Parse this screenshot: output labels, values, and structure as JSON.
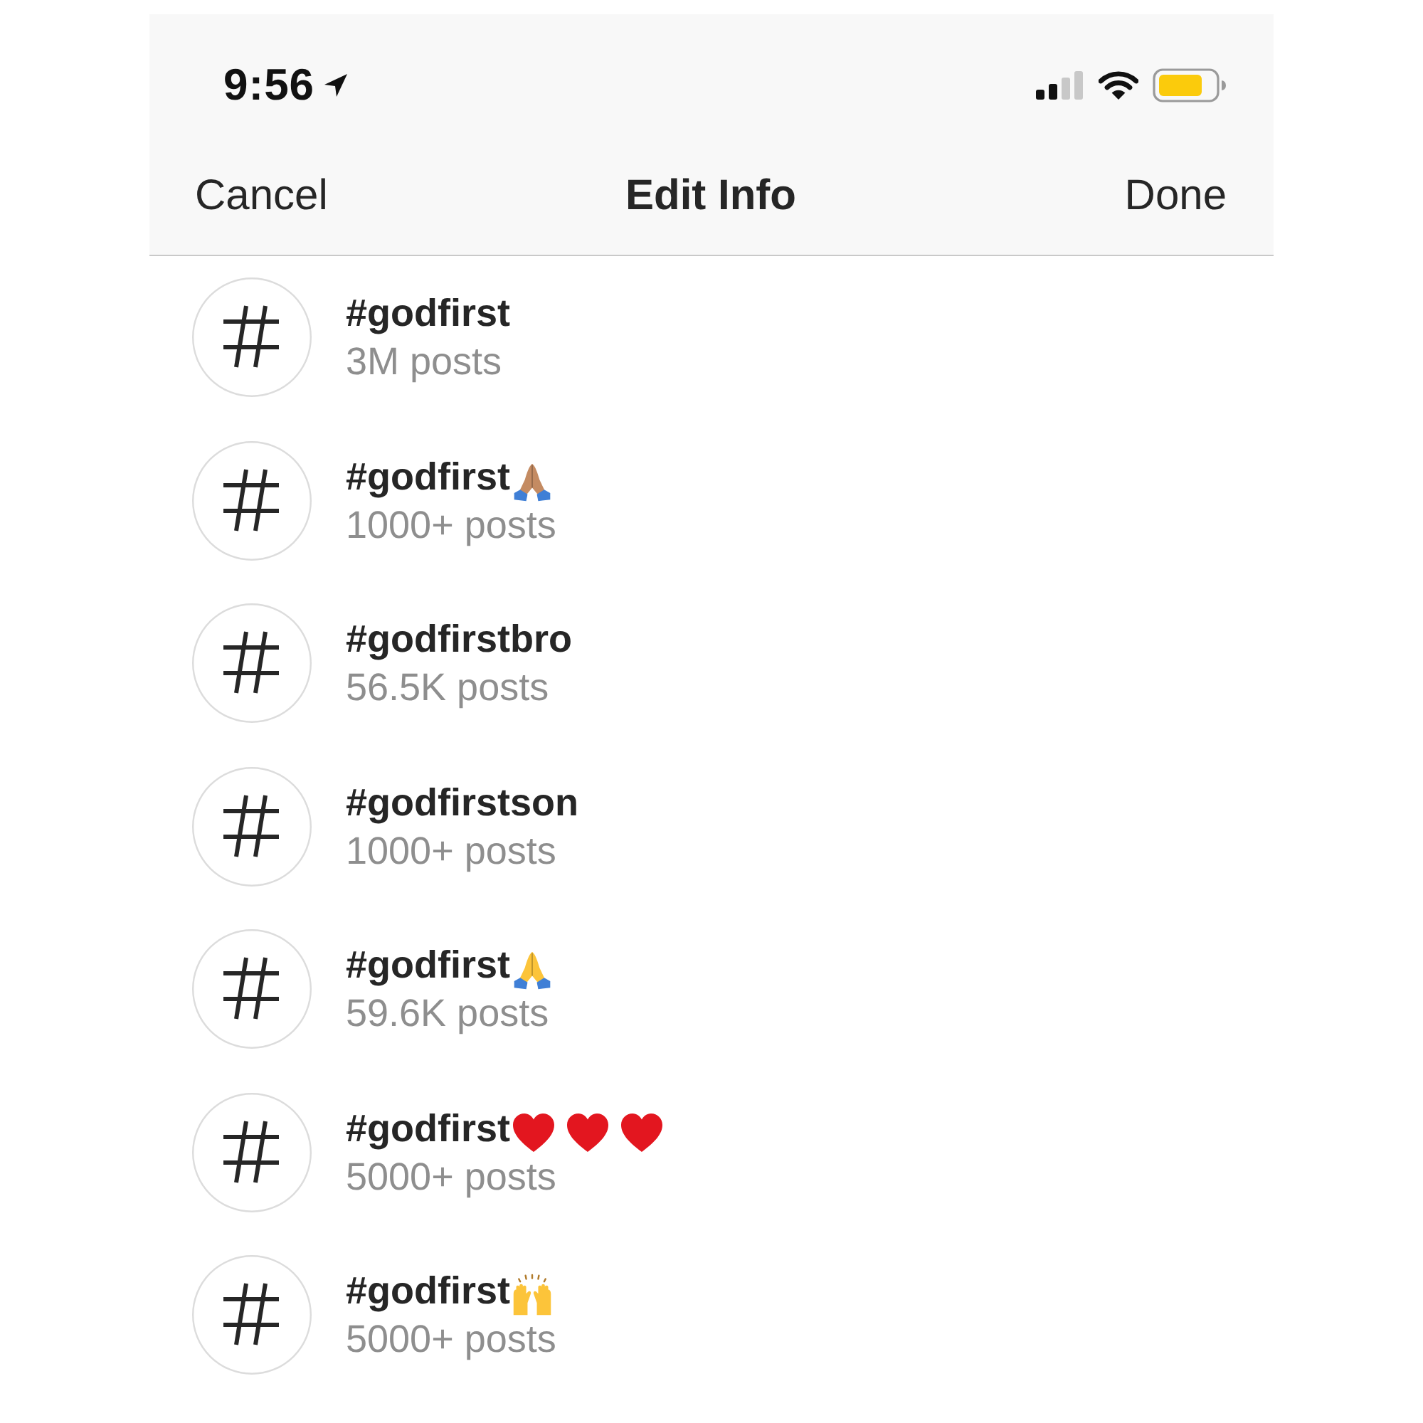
{
  "status_bar": {
    "time": "9:56"
  },
  "nav_bar": {
    "left_button": "Cancel",
    "title": "Edit Info",
    "right_button": "Done"
  },
  "hashtags": [
    {
      "tag": "#godfirst",
      "count": "3M posts"
    },
    {
      "tag": "#godfirst",
      "emojis": [
        {
          "kind": "praying-hands",
          "color": "#c48b62"
        }
      ],
      "count": "1000+ posts"
    },
    {
      "tag": "#godfirstbro",
      "count": "56.5K posts"
    },
    {
      "tag": "#godfirstson",
      "count": "1000+ posts"
    },
    {
      "tag": "#godfirst",
      "emojis": [
        {
          "kind": "praying-hands",
          "color": "#fcc43a"
        }
      ],
      "count": "59.6K posts"
    },
    {
      "tag": "#godfirst",
      "emojis": [
        {
          "kind": "heart",
          "color": "#e3161f"
        },
        {
          "kind": "heart",
          "color": "#e3161f"
        },
        {
          "kind": "heart",
          "color": "#e3161f"
        }
      ],
      "count": "5000+ posts"
    },
    {
      "tag": "#godfirst",
      "emojis": [
        {
          "kind": "raised-hands",
          "color": "#fcc43a"
        }
      ],
      "count": "5000+ posts"
    }
  ]
}
